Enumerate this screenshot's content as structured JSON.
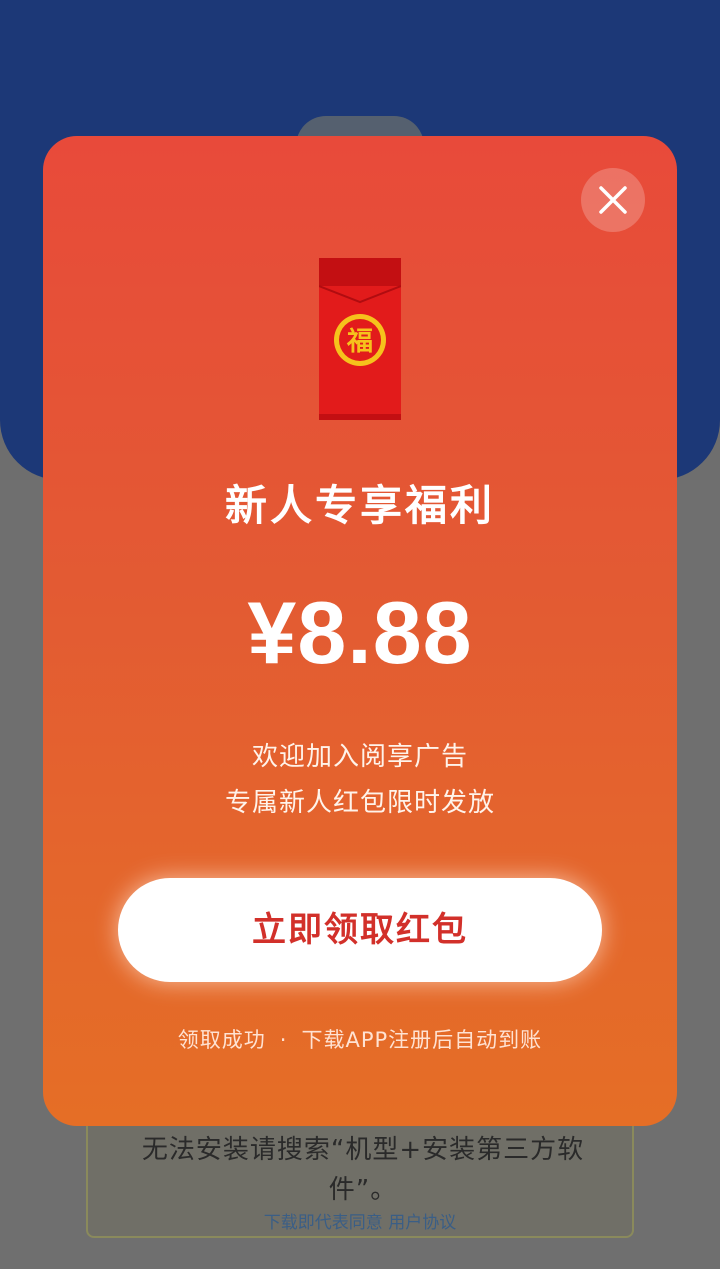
{
  "background": {
    "hint_text": "无法安装请搜索“机型+安装第三方软件”。",
    "agreement_text": "下载即代表同意 用户协议"
  },
  "modal": {
    "close_icon": "close-icon",
    "envelope_icon": "red-envelope-fu-icon",
    "title": "新人专享福利",
    "amount": "¥8.88",
    "desc_line1": "欢迎加入阅享广告",
    "desc_line2": "专属新人红包限时发放",
    "claim_button": "立即领取红包",
    "footnote_left": "领取成功",
    "footnote_sep": "·",
    "footnote_right": "下载APP注册后自动到账"
  },
  "colors": {
    "modal_top": "#e84a3a",
    "modal_bottom": "#e56e26",
    "button_text": "#d2302a",
    "background_blue": "#1c3877"
  }
}
